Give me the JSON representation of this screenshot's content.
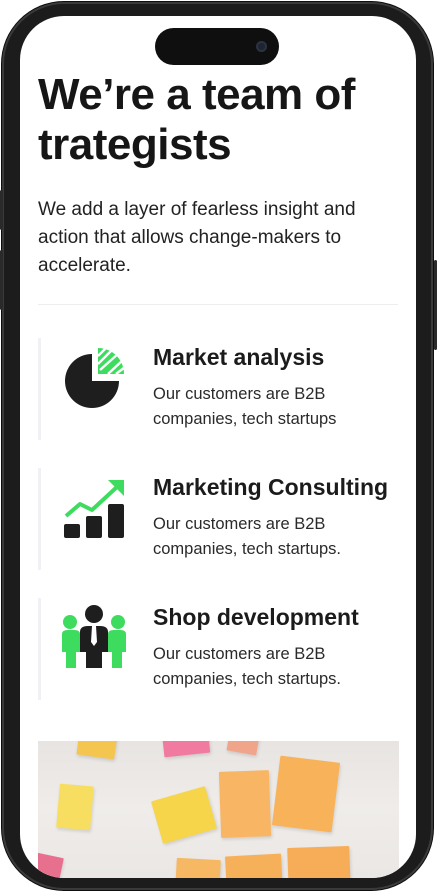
{
  "hero": {
    "title": "We’re a team of trategists",
    "intro": "We add a layer of fearless insight and action that allows change-makers to accelerate."
  },
  "services": [
    {
      "title": "Market analysis",
      "description": "Our customers are B2B companies, tech startups",
      "icon": "pie-chart-icon"
    },
    {
      "title": "Marketing Consulting",
      "description": "Our customers are B2B companies, tech startups.",
      "icon": "growth-chart-icon"
    },
    {
      "title": "Shop development",
      "description": "Our customers are B2B companies, tech startups.",
      "icon": "team-icon"
    }
  ],
  "colors": {
    "accent": "#3ddc5f",
    "dark": "#1b1b1b"
  },
  "image": {
    "subject": "sticky-notes-photo"
  }
}
